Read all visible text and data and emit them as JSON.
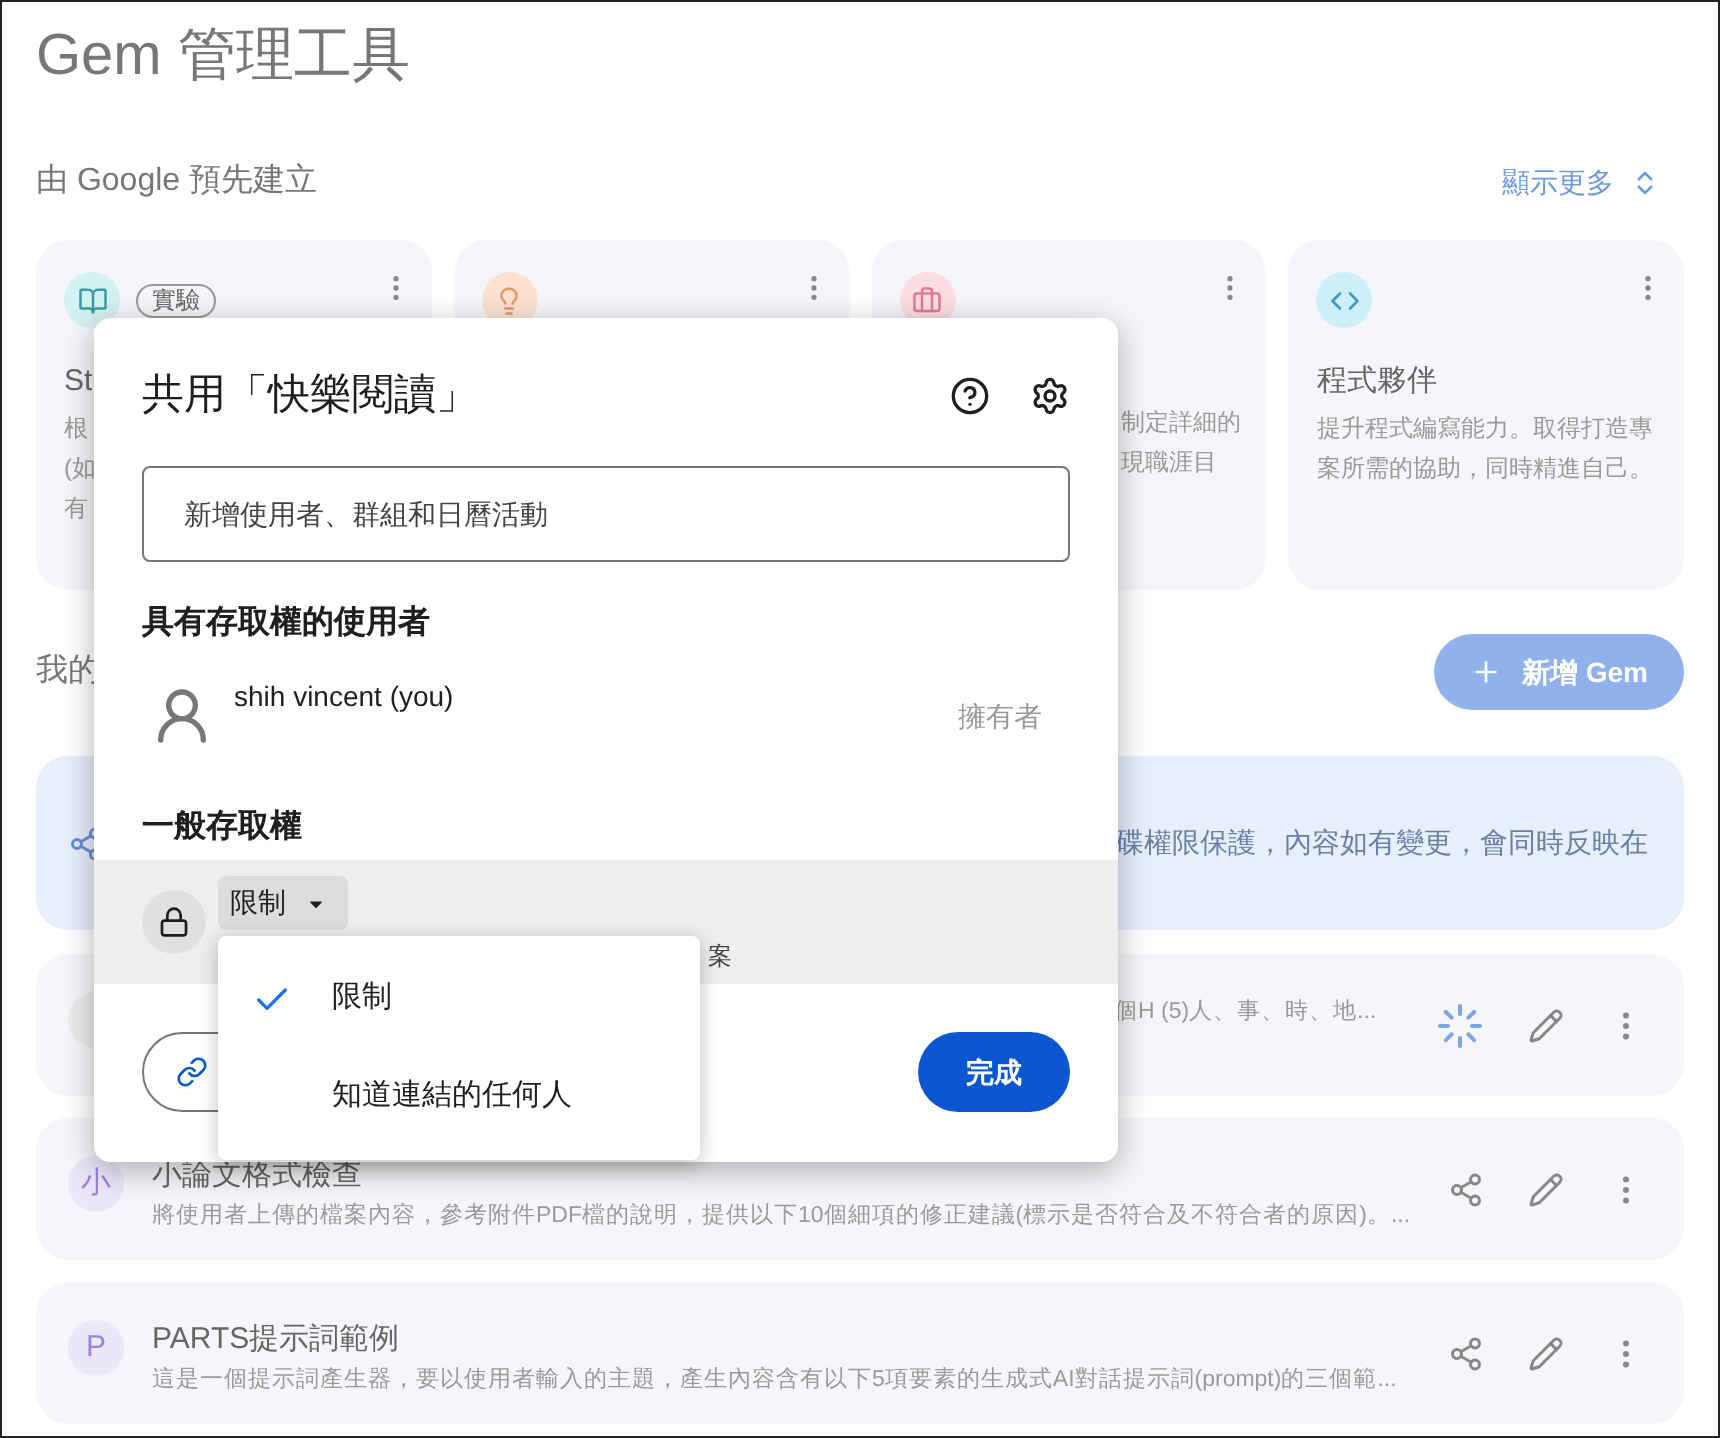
{
  "page": {
    "title": "Gem 管理工具"
  },
  "premade": {
    "heading": "由 Google 預先建立",
    "show_more": "顯示更多",
    "cards": [
      {
        "kind": "book",
        "badge": "實驗",
        "title": "St",
        "description_lines": [
          "根",
          "(如",
          "有"
        ]
      },
      {
        "kind": "bulb"
      },
      {
        "kind": "briefcase",
        "description_lines": [
          "制定詳細的",
          "現職涯目"
        ]
      },
      {
        "kind": "code",
        "title": "程式夥伴",
        "description_lines": [
          "提升程式編寫能力。取得打造專",
          "案所需的協助，同時精進自己。"
        ]
      }
    ]
  },
  "mine": {
    "heading": "我的",
    "new_button": "新增 Gem",
    "banner": "碟權限保護，內容如有變更，會同時反映在",
    "gems": [
      {
        "kind": "loading",
        "description": "個H (5)人、事、時、地..."
      },
      {
        "kind": "shared",
        "letter": "小",
        "title": "小論文格式檢查",
        "description": "將使用者上傳的檔案內容，參考附件PDF檔的說明，提供以下10個細項的修正建議(標示是否符合及不符合者的原因)。..."
      },
      {
        "kind": "shared",
        "letter": "P",
        "title": "PARTS提示詞範例",
        "description": "這是一個提示詞產生器，要以使用者輸入的主題，產生內容含有以下5項要素的生成式AI對話提示詞(prompt)的三個範..."
      }
    ]
  },
  "dialog": {
    "title": "共用「快樂閱讀」",
    "invite_placeholder": "新增使用者、群組和日曆活動",
    "people_heading": "具有存取權的使用者",
    "people": [
      {
        "name": "shih vincent (you)",
        "role": "擁有者"
      }
    ],
    "general_heading": "一般存取權",
    "access": {
      "value": "限制",
      "note": "案"
    },
    "done": "完成",
    "menu": [
      {
        "label": "限制",
        "selected": true
      },
      {
        "label": "知道連結的任何人",
        "selected": false
      }
    ]
  }
}
